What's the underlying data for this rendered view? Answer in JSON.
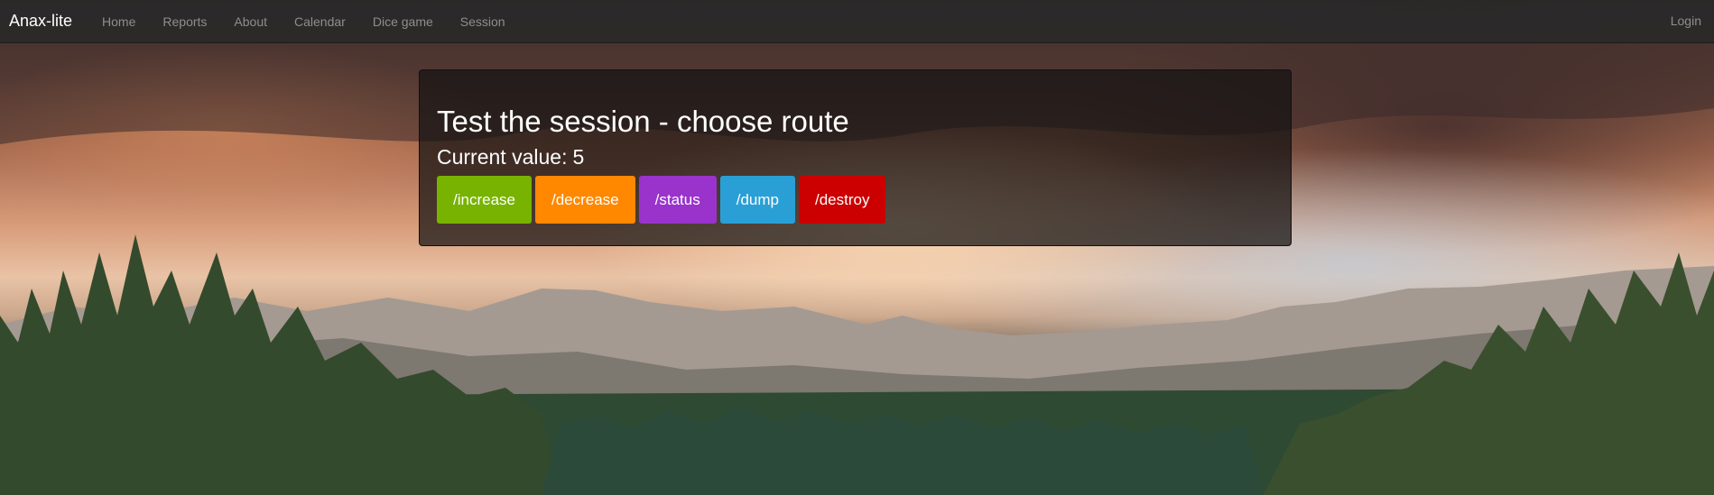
{
  "navbar": {
    "brand": "Anax-lite",
    "links": [
      "Home",
      "Reports",
      "About",
      "Calendar",
      "Dice game",
      "Session"
    ],
    "right_link": "Login"
  },
  "panel": {
    "title": "Test the session - choose route",
    "current_label": "Current value:",
    "current_value": "5",
    "buttons": [
      {
        "label": "/increase",
        "color": "#77b300"
      },
      {
        "label": "/decrease",
        "color": "#ff8800"
      },
      {
        "label": "/status",
        "color": "#9933cc"
      },
      {
        "label": "/dump",
        "color": "#2a9fd6"
      },
      {
        "label": "/destroy",
        "color": "#cc0000"
      }
    ]
  },
  "colors": {
    "navbar_bg": "#282828",
    "nav_link": "#8e8e8e",
    "text": "#ffffff"
  }
}
